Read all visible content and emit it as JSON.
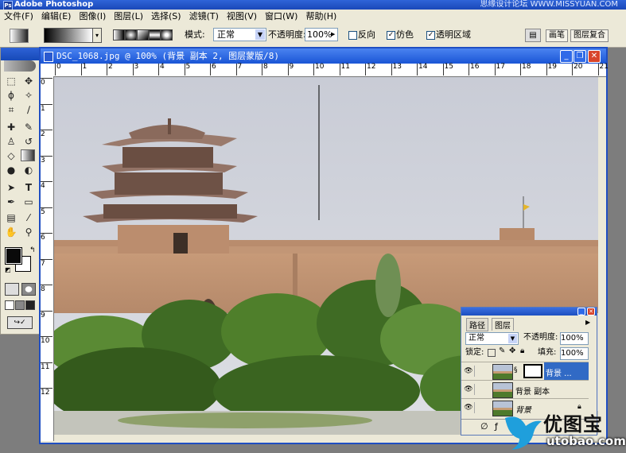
{
  "app": {
    "title": "Adobe Photoshop",
    "ps_icon": "Ps",
    "watermark_top": "思缘设计论坛  WWW.MISSYUAN.COM"
  },
  "menu": [
    "文件(F)",
    "编辑(E)",
    "图像(I)",
    "图层(L)",
    "选择(S)",
    "滤镜(T)",
    "视图(V)",
    "窗口(W)",
    "帮助(H)"
  ],
  "window_controls": {
    "minimize": "_",
    "restore": "❐",
    "close": "✕"
  },
  "options": {
    "mode_label": "模式:",
    "mode_value": "正常",
    "opacity_label": "不透明度:",
    "opacity_value": "100%",
    "reverse_label": "反向",
    "reverse_checked": false,
    "dither_label": "仿色",
    "dither_checked": true,
    "transparency_label": "透明区域",
    "transparency_checked": true,
    "palette_tabs": [
      "画笔",
      "图层复合"
    ]
  },
  "toolbox": {
    "tools": [
      "marquee-icon",
      "move-icon",
      "lasso-icon",
      "magic-wand-icon",
      "crop-icon",
      "slice-icon",
      "healing-icon",
      "brush-icon",
      "stamp-icon",
      "history-brush-icon",
      "eraser-icon",
      "gradient-icon",
      "blur-icon",
      "dodge-icon",
      "path-select-icon",
      "type-icon",
      "pen-icon",
      "shape-icon",
      "notes-icon",
      "eyedropper-icon",
      "hand-icon",
      "zoom-icon"
    ],
    "foreground_color": "#0a0a0a",
    "background_color": "#ffffff"
  },
  "document": {
    "title": "DSC_1068.jpg @ 100% (背景 副本 2, 图层蒙版/8)",
    "ruler_h": [
      "0",
      "1",
      "2",
      "3",
      "4",
      "5",
      "6",
      "7",
      "8",
      "9",
      "10",
      "11",
      "12",
      "13",
      "14",
      "15",
      "16",
      "17",
      "18",
      "19",
      "20",
      "21"
    ],
    "ruler_v": [
      "0",
      "1",
      "2",
      "3",
      "4",
      "5",
      "6",
      "7",
      "8",
      "9",
      "10",
      "11",
      "12"
    ]
  },
  "layers_panel": {
    "tabs": [
      "路径",
      "图层"
    ],
    "blend_mode": "正常",
    "opacity_label": "不透明度:",
    "opacity_value": "100%",
    "lock_label": "锁定:",
    "fill_label": "填充:",
    "fill_value": "100%",
    "layers": [
      {
        "name": "背景 ...",
        "visible": true,
        "selected": true,
        "has_mask": true
      },
      {
        "name": "背景 副本",
        "visible": true,
        "selected": false,
        "has_mask": false
      },
      {
        "name": "背景",
        "visible": true,
        "selected": false,
        "locked": true
      }
    ]
  },
  "watermark": {
    "brand_cn": "优图宝",
    "brand_url": "utobao.com"
  },
  "colors": {
    "accent": "#1f4ec2",
    "panel": "#ece9d8",
    "selected_layer": "#316ac5"
  }
}
